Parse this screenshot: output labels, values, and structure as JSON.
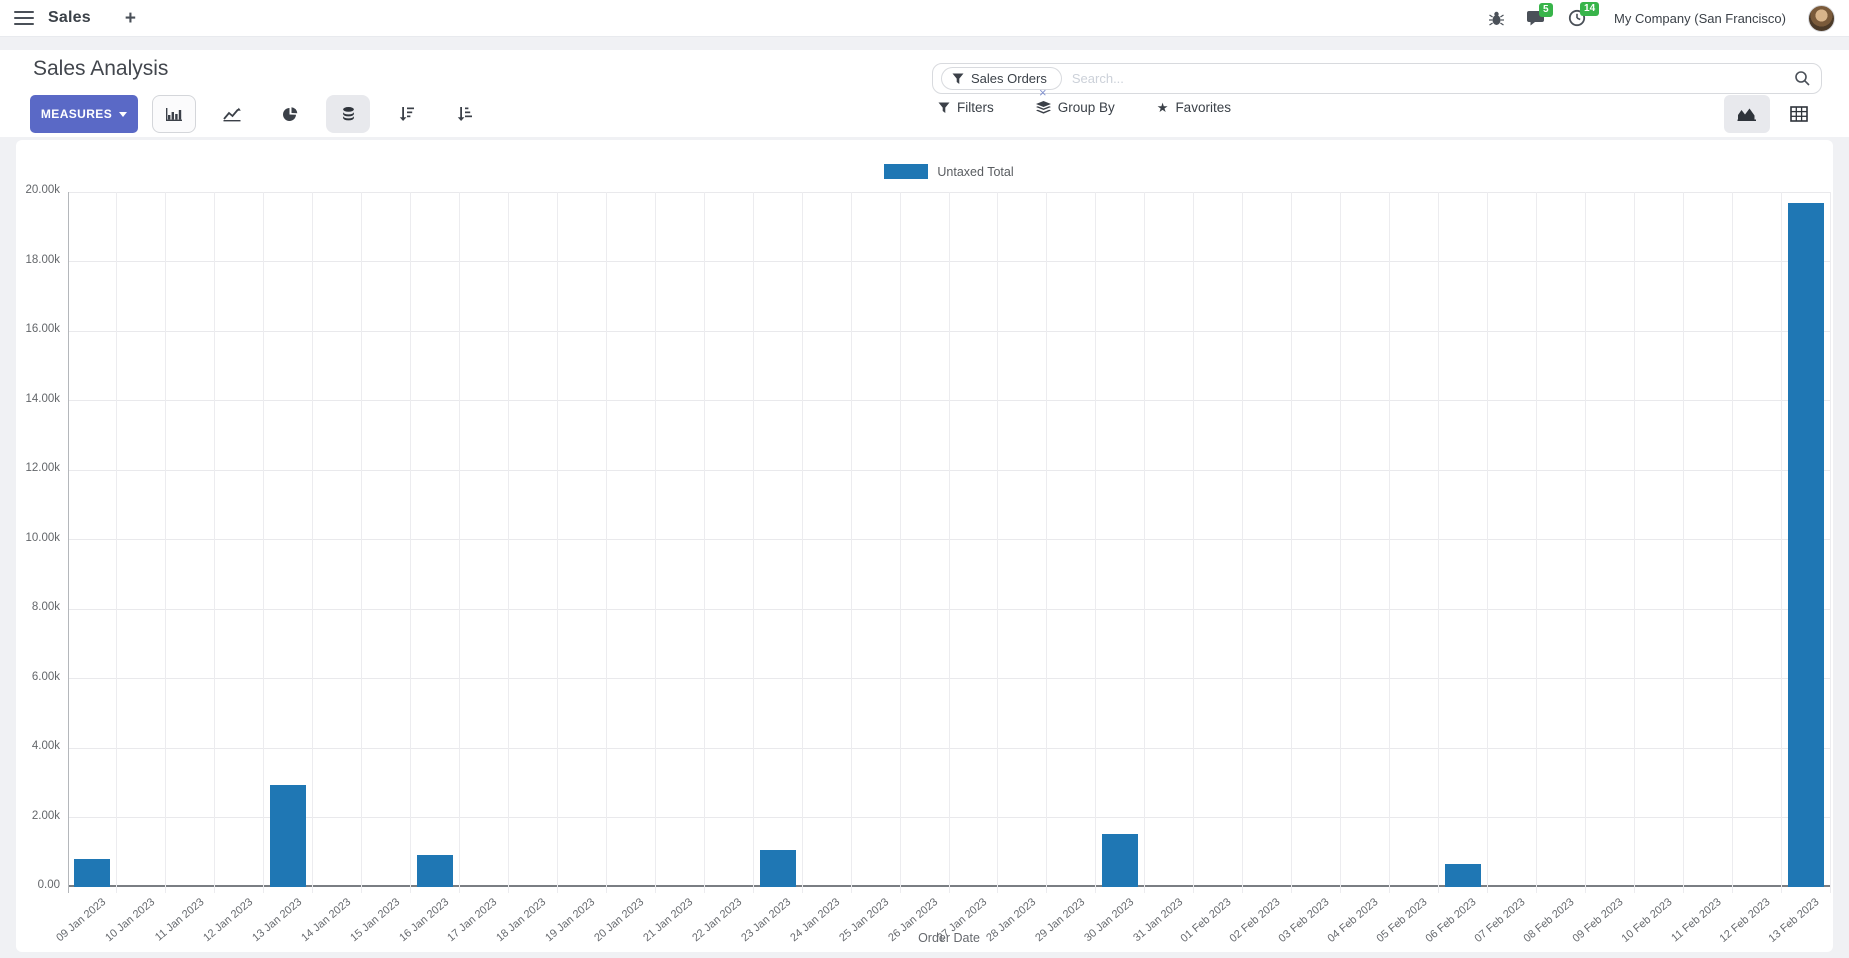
{
  "navbar": {
    "brand": "Sales",
    "plus_label": "+",
    "messages_badge": "5",
    "activities_badge": "14",
    "company": "My Company (San Francisco)"
  },
  "control_panel": {
    "title": "Sales Analysis",
    "measures_label": "MEASURES",
    "search": {
      "facet_label": "Sales Orders",
      "facet_remove": "×",
      "placeholder": "Search..."
    },
    "filters_label": "Filters",
    "group_by_label": "Group By",
    "favorites_label": "Favorites"
  },
  "chart_data": {
    "type": "bar",
    "title": "",
    "xlabel": "Order Date",
    "ylabel": "",
    "ylim": [
      0,
      20000
    ],
    "grid": true,
    "legend_position": "top-center",
    "legend": {
      "label": "Untaxed Total",
      "color": "#1f77b4"
    },
    "bar_color": "#1f77b4",
    "y_ticks": [
      "0.00",
      "2.00k",
      "4.00k",
      "6.00k",
      "8.00k",
      "10.00k",
      "12.00k",
      "14.00k",
      "16.00k",
      "18.00k",
      "20.00k"
    ],
    "categories": [
      "09 Jan 2023",
      "10 Jan 2023",
      "11 Jan 2023",
      "12 Jan 2023",
      "13 Jan 2023",
      "14 Jan 2023",
      "15 Jan 2023",
      "16 Jan 2023",
      "17 Jan 2023",
      "18 Jan 2023",
      "19 Jan 2023",
      "20 Jan 2023",
      "21 Jan 2023",
      "22 Jan 2023",
      "23 Jan 2023",
      "24 Jan 2023",
      "25 Jan 2023",
      "26 Jan 2023",
      "27 Jan 2023",
      "28 Jan 2023",
      "29 Jan 2023",
      "30 Jan 2023",
      "31 Jan 2023",
      "01 Feb 2023",
      "02 Feb 2023",
      "03 Feb 2023",
      "04 Feb 2023",
      "05 Feb 2023",
      "06 Feb 2023",
      "07 Feb 2023",
      "08 Feb 2023",
      "09 Feb 2023",
      "10 Feb 2023",
      "11 Feb 2023",
      "12 Feb 2023",
      "13 Feb 2023"
    ],
    "values": [
      800,
      0,
      0,
      0,
      2930,
      0,
      0,
      920,
      0,
      0,
      0,
      0,
      0,
      0,
      1060,
      0,
      0,
      0,
      0,
      0,
      0,
      1520,
      0,
      0,
      0,
      0,
      0,
      0,
      660,
      0,
      0,
      0,
      0,
      0,
      0,
      19680
    ]
  }
}
